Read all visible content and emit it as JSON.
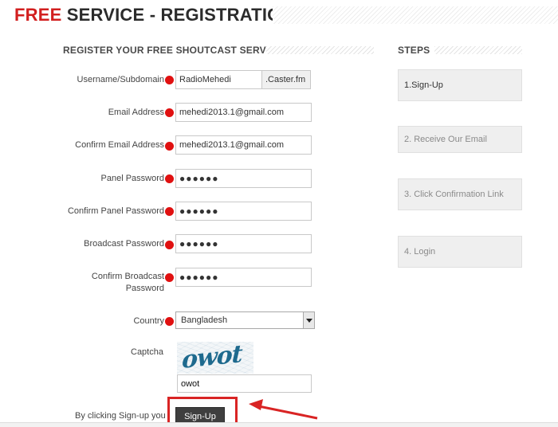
{
  "header": {
    "title_free": "FREE",
    "title_rest": "SERVICE - REGISTRATION"
  },
  "form": {
    "heading": "REGISTER YOUR FREE SHOUTCAST SERVER",
    "fields": [
      {
        "label": "Username/Subdomain",
        "value": "RadioMehedi",
        "suffix": ".Caster.fm"
      },
      {
        "label": "Email Address",
        "value": "mehedi2013.1@gmail.com"
      },
      {
        "label": "Confirm Email Address",
        "value": "mehedi2013.1@gmail.com"
      },
      {
        "label": "Panel Password",
        "value": "●●●●●●"
      },
      {
        "label": "Confirm Panel Password",
        "value": "●●●●●●"
      },
      {
        "label": "Broadcast Password",
        "value": "●●●●●●"
      },
      {
        "label_line1": "Confirm Broadcast",
        "label_line2": "Password",
        "value": "●●●●●●"
      }
    ],
    "country": {
      "label": "Country",
      "value": "Bangladesh"
    },
    "captcha": {
      "label": "Captcha",
      "image_text": "owot",
      "value": "owot"
    },
    "terms_text": "By clicking Sign-up you",
    "signup_label": "Sign-Up"
  },
  "steps": {
    "heading": "STEPS",
    "items": [
      {
        "label": "1.Sign-Up"
      },
      {
        "label": "2. Receive Our Email"
      },
      {
        "label": "3. Click Confirmation Link"
      },
      {
        "label": "4. Login"
      }
    ]
  },
  "colors": {
    "accent_red": "#d21f1f",
    "annotation_red": "#d92424",
    "button_dark": "#3f3f3f"
  }
}
